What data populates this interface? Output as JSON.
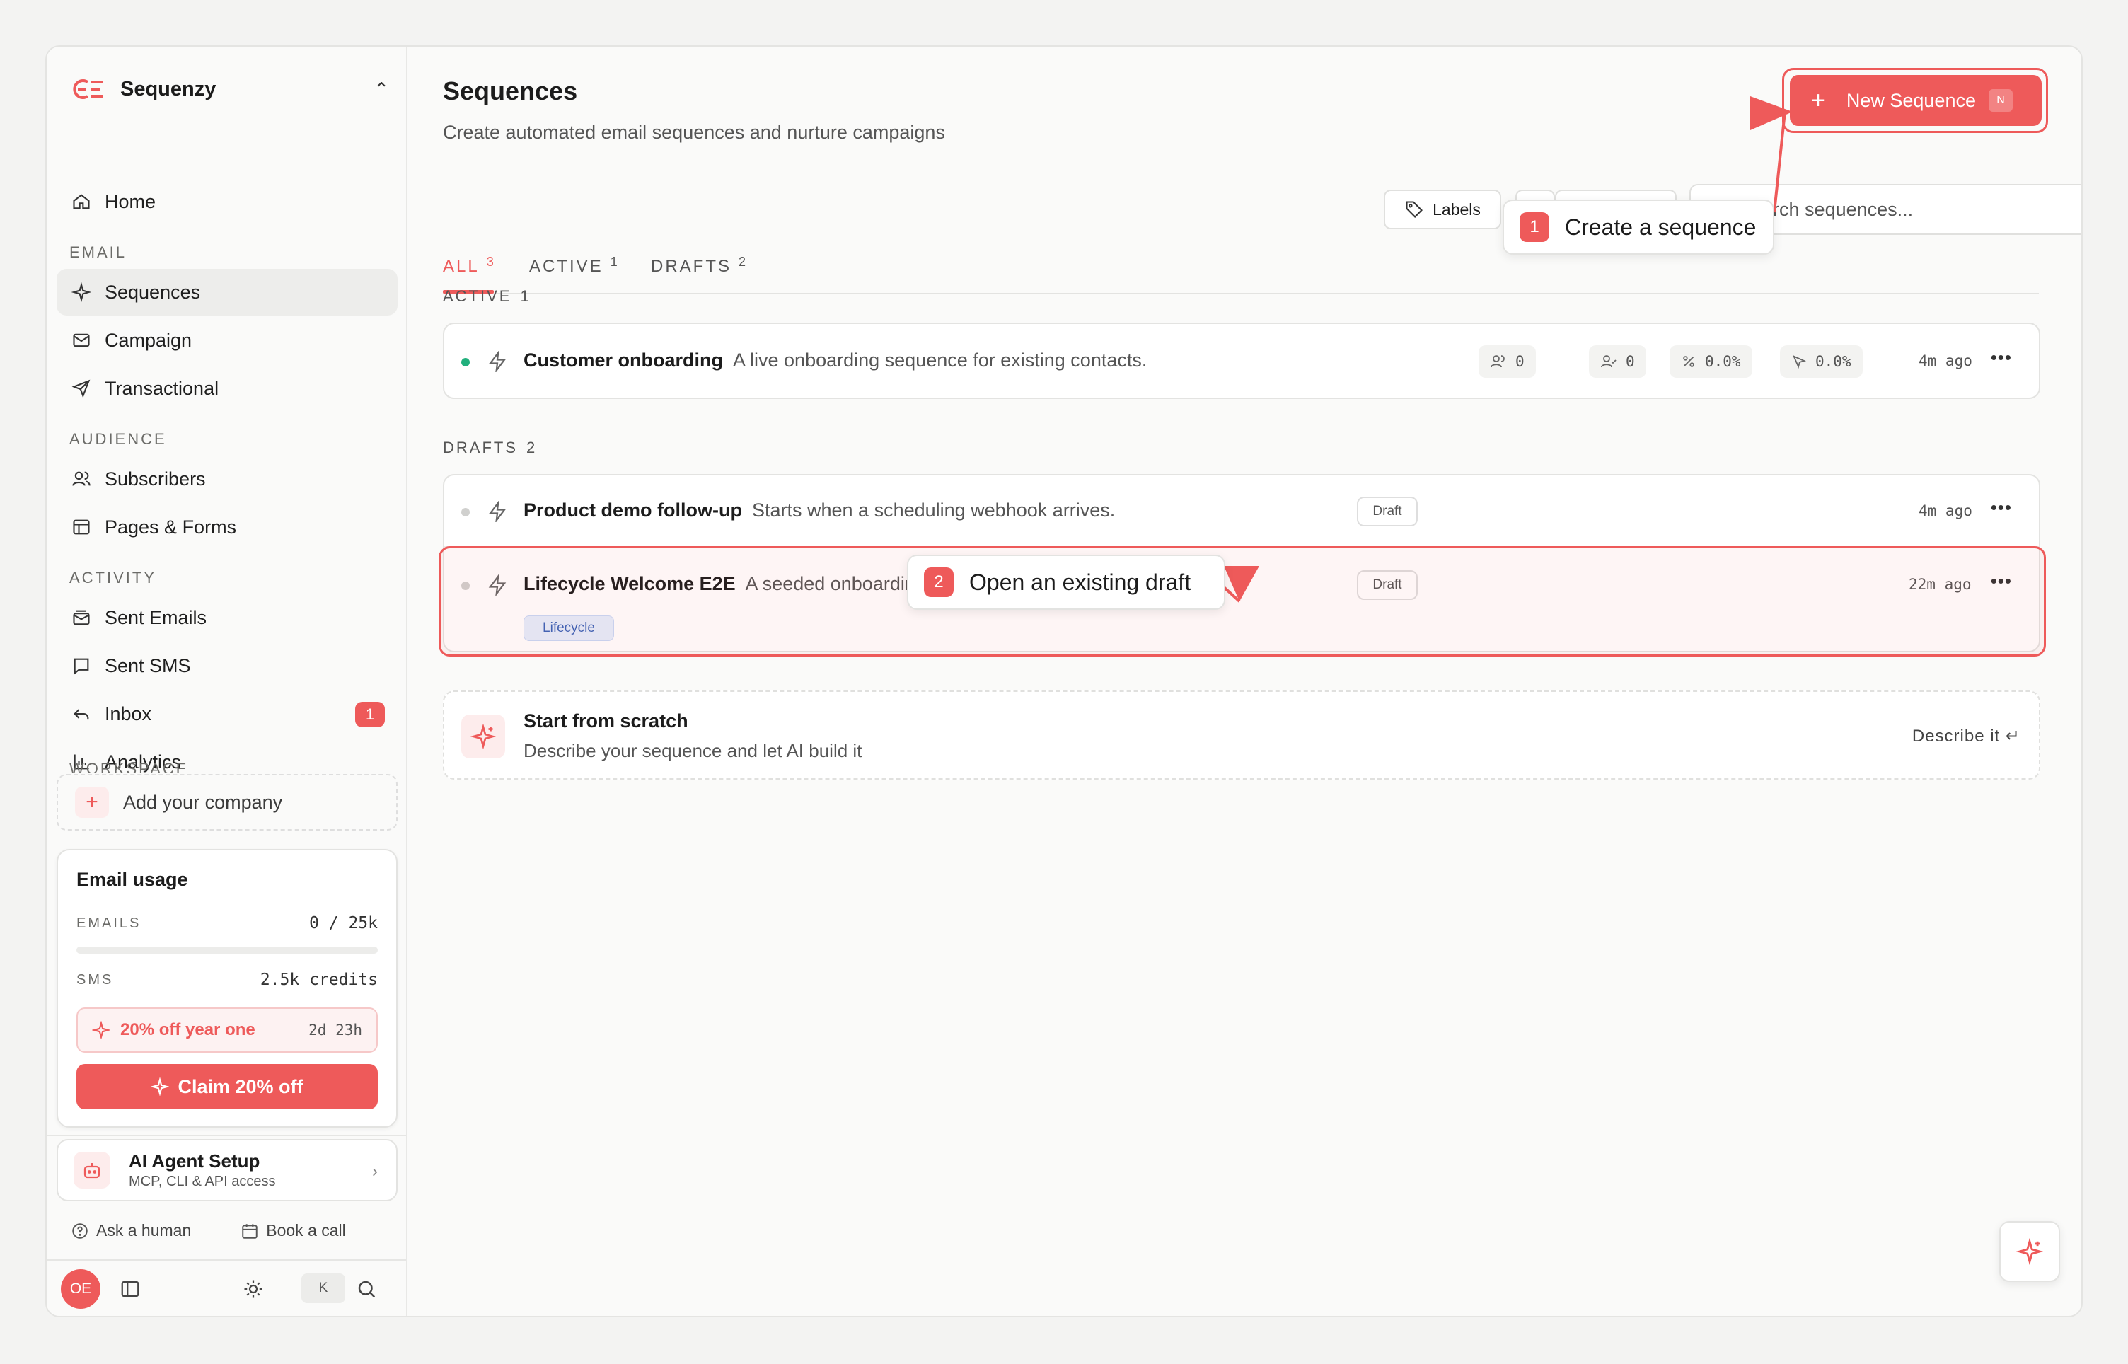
{
  "brand": {
    "name": "Sequenzy"
  },
  "sidebar": {
    "items": [
      {
        "label": "Home",
        "icon": "home-icon"
      },
      {
        "label": "Sequences",
        "icon": "sparkles-icon",
        "active": true
      },
      {
        "label": "Campaign",
        "icon": "mail-icon"
      },
      {
        "label": "Transactional",
        "icon": "send-icon"
      },
      {
        "label": "Subscribers",
        "icon": "users-icon"
      },
      {
        "label": "Pages & Forms",
        "icon": "layout-icon"
      },
      {
        "label": "Sent Emails",
        "icon": "mail-stack-icon"
      },
      {
        "label": "Sent SMS",
        "icon": "message-icon"
      },
      {
        "label": "Inbox",
        "icon": "reply-icon",
        "badge": "1"
      },
      {
        "label": "Analytics",
        "icon": "bar-chart-icon"
      }
    ],
    "sections": {
      "email": "EMAIL",
      "audience": "AUDIENCE",
      "activity": "ACTIVITY",
      "workspace": "WORKSPACE"
    },
    "add_company": "Add your company",
    "usage": {
      "title": "Email usage",
      "emails_label": "EMAILS",
      "emails_value": "0 / 25k",
      "emails_fraction": 0,
      "sms_label": "SMS",
      "sms_value": "2.5k credits",
      "promo_text": "20% off year one",
      "promo_time": "2d 23h",
      "claim_label": "Claim 20% off"
    },
    "agent": {
      "title": "AI Agent Setup",
      "subtitle": "MCP, CLI & API access"
    },
    "helpers": {
      "ask": "Ask a human",
      "book": "Book a call"
    },
    "avatar": "OE",
    "kbd": "K"
  },
  "page": {
    "title": "Sequences",
    "subtitle": "Create automated email sequences and nurture campaigns",
    "new_button": "New Sequence",
    "new_button_kbd": "N",
    "tabs": [
      {
        "label": "ALL",
        "count": "3",
        "active": true
      },
      {
        "label": "ACTIVE",
        "count": "1"
      },
      {
        "label": "DRAFTS",
        "count": "2"
      }
    ],
    "labels_button": "Labels",
    "search_placeholder": "Search sequences..."
  },
  "groups": {
    "active": {
      "label": "ACTIVE",
      "count": "1"
    },
    "drafts": {
      "label": "DRAFTS",
      "count": "2"
    }
  },
  "sequences": {
    "active": [
      {
        "name": "Customer onboarding",
        "description": "A live onboarding sequence for existing contacts.",
        "subscribers": "0",
        "completed": "0",
        "open_rate": "0.0%",
        "click_rate": "0.0%",
        "updated": "4m ago"
      }
    ],
    "drafts": [
      {
        "name": "Product demo follow-up",
        "description": "Starts when a scheduling webhook arrives.",
        "status": "Draft",
        "updated": "4m ago"
      },
      {
        "name": "Lifecycle Welcome E2E",
        "description": "A seeded onboarding sequence",
        "status": "Draft",
        "tag": "Lifecycle",
        "updated": "22m ago"
      }
    ]
  },
  "scratch": {
    "title": "Start from scratch",
    "subtitle": "Describe your sequence and let AI build it",
    "action": "Describe it"
  },
  "callouts": {
    "create": {
      "num": "1",
      "text": "Create a sequence"
    },
    "open": {
      "num": "2",
      "text": "Open an existing draft"
    }
  },
  "colors": {
    "accent": "#ee5a5a",
    "active_dot": "#22b07d",
    "draft_dot": "#d0d0ce"
  }
}
